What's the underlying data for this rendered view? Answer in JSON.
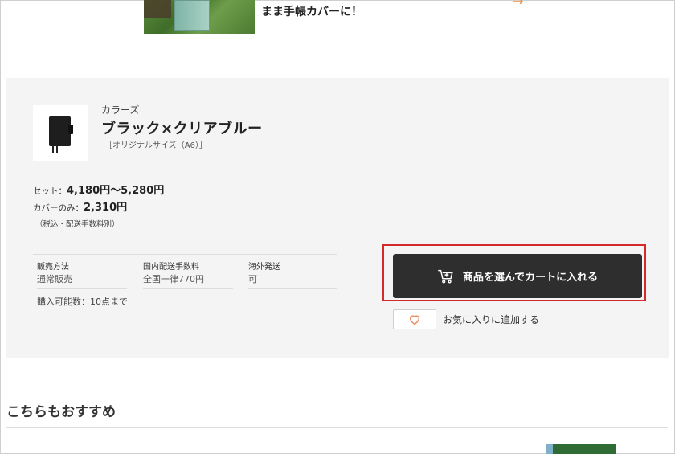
{
  "banner": {
    "text": "まま手帳カバーに！",
    "arrow": "→"
  },
  "product": {
    "colors_label": "カラーズ",
    "name": "ブラック×クリアブルー",
    "size_note": "［オリジナルサイズ（A6）］"
  },
  "pricing": {
    "set_label": "セット：",
    "set_price": "4,180円〜5,280円",
    "cover_label": "カバーのみ：",
    "cover_price": "2,310円",
    "tax_note": "（税込・配送手数料別）"
  },
  "info": {
    "sales_method_header": "販売方法",
    "sales_method_value": "通常販売",
    "shipping_header": "国内配送手数料",
    "shipping_value": "全国一律770円",
    "overseas_header": "海外発送",
    "overseas_value": "可",
    "purchase_limit": "購入可能数：10点まで"
  },
  "actions": {
    "cart_label": "商品を選んでカートに入れる",
    "cart_icon": "cart-icon",
    "favorite_label": "お気に入りに追加する",
    "favorite_icon": "heart-icon",
    "highlight_color": "#d42a2a",
    "heart_color": "#f08a5d"
  },
  "recommend": {
    "title": "こちらもおすすめ"
  }
}
